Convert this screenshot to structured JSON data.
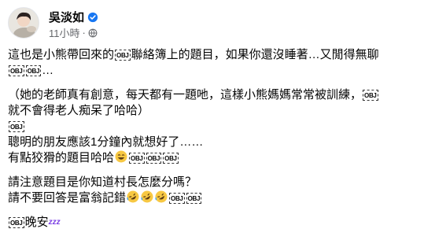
{
  "post": {
    "author": "吳淡如",
    "time": "11小時",
    "dot": "·",
    "lines": {
      "l1_a": "這也是小熊帶回來的",
      "l1_b": "聯絡簿上的題目，如果你還沒睡著…又閒得無聊",
      "l2_b": "…",
      "l3_a": "（她的老師真有創意，每天都有一題吔，這樣小熊媽媽常常被訓練，",
      "l4_a": "就不會得老人痴呆了哈哈）",
      "l6_a": "聰明的朋友應該1分鐘內就想好了……",
      "l7_a": "有點狡猾的題目哈哈",
      "l8_a": "請注意題目是你知道村長怎麼分嗎？",
      "l9_a": "請不要回答是富翁記錯",
      "l10_b": "晚安"
    },
    "obj_label": "OBJ",
    "zzz": "zzz"
  },
  "icons": {
    "verified": "verified-badge-icon",
    "audience": "globe-icon",
    "laugh_emoji": "rolling-laughing-emoji",
    "smile_emoji": "grinning-emoji"
  },
  "colors": {
    "verified": "#1877f2",
    "meta": "#65676b",
    "emoji": "#f7c843"
  }
}
